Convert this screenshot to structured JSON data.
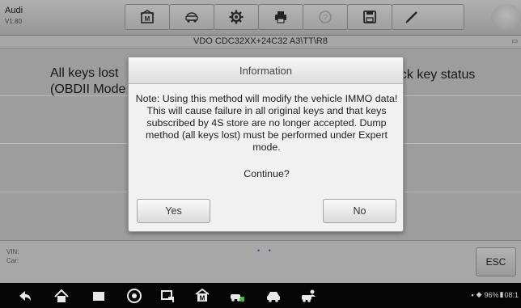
{
  "header": {
    "app_name": "Audi",
    "version": "V1.80"
  },
  "toolbar": {
    "buttons": [
      "home-icon",
      "vehicle-swap-icon",
      "settings-gear-icon",
      "print-icon",
      "help-icon",
      "save-icon",
      "edit-pen-icon"
    ]
  },
  "subheader": {
    "title": "VDO CDC32XX+24C32 A3\\TT\\R8"
  },
  "content": {
    "item_left_line1": "All keys lost",
    "item_left_line2": "(OBDII Mode",
    "item_right": "eck key status"
  },
  "footer": {
    "vin_label": "VIN:",
    "car_label": "Car:",
    "esc_label": "ESC",
    "page_dots": "• •"
  },
  "dialog": {
    "title": "Information",
    "message": "Note: Using this method will modify the vehicle IMMO data! This will cause failure in all original keys and that keys subscribed by 4S store are no longer accepted. Dump method (all keys lost) must be performed under Expert mode.",
    "question": "Continue?",
    "yes_label": "Yes",
    "no_label": "No"
  },
  "status_bar": {
    "battery": "96%",
    "time": "08:1"
  },
  "colors": {
    "accent_blue": "#3a6fbf",
    "nav_bg": "#050505"
  }
}
